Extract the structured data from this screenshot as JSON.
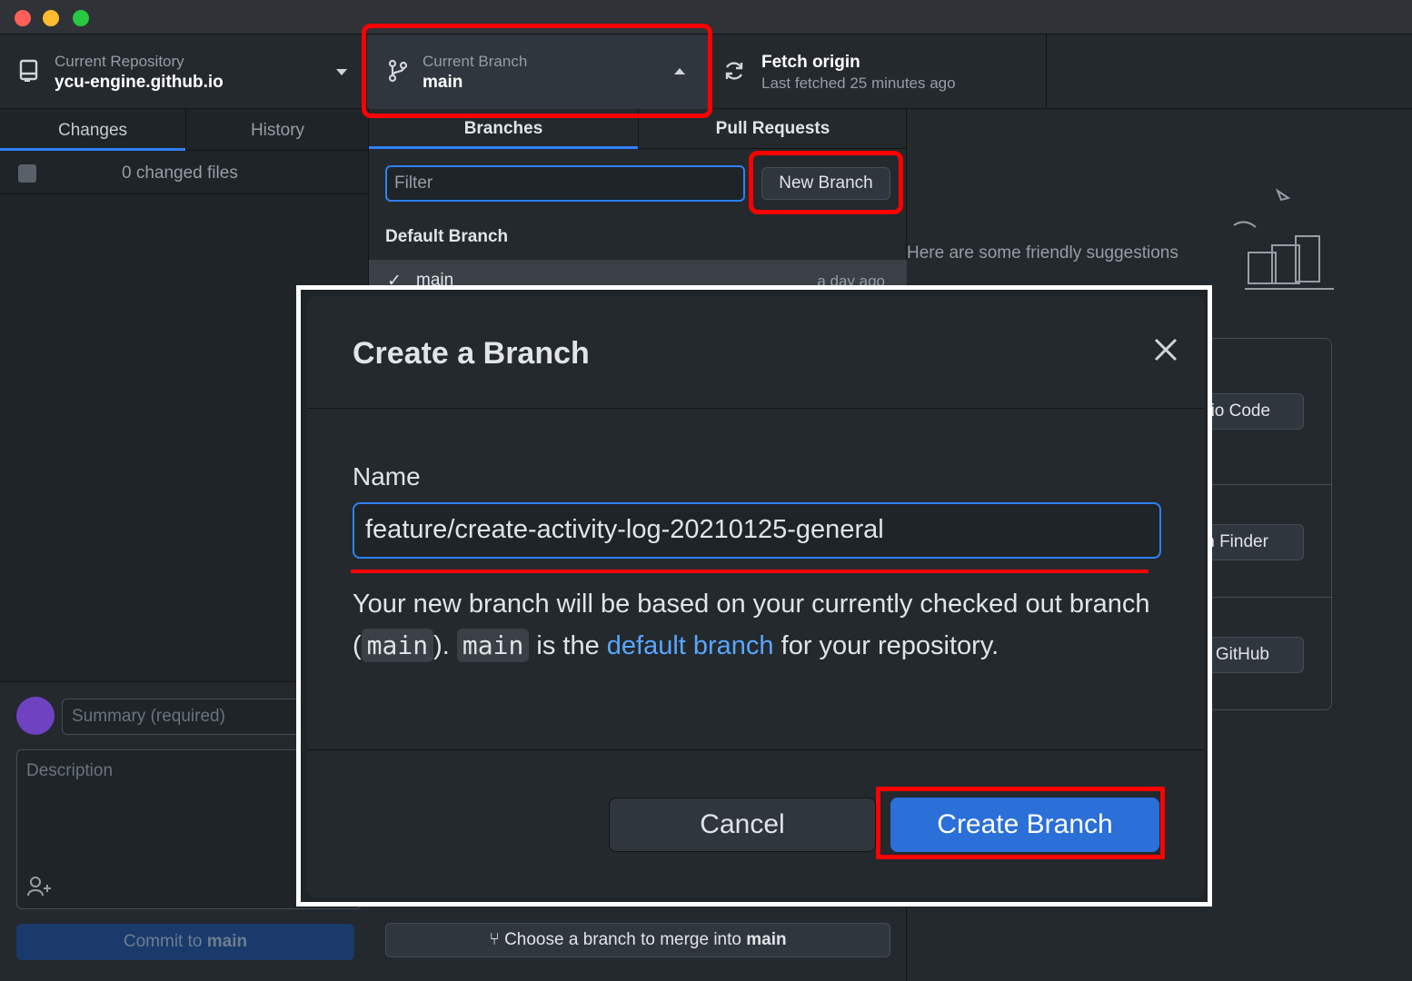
{
  "window": {
    "traffic_lights": [
      "close",
      "minimize",
      "zoom"
    ]
  },
  "toolbar": {
    "repo_label": "Current Repository",
    "repo_name": "ycu-engine.github.io",
    "branch_label": "Current Branch",
    "branch_name": "main",
    "fetch_title": "Fetch origin",
    "fetch_subtitle": "Last fetched 25 minutes ago"
  },
  "sidebar": {
    "tabs": [
      "Changes",
      "History"
    ],
    "changed_files": "0 changed files",
    "summary_placeholder": "Summary (required)",
    "description_placeholder": "Description",
    "commit_prefix": "Commit to ",
    "commit_branch": "main"
  },
  "branch_dropdown": {
    "tabs": [
      "Branches",
      "Pull Requests"
    ],
    "filter_placeholder": "Filter",
    "new_branch_label": "New Branch",
    "default_branch_heading": "Default Branch",
    "branches": [
      {
        "name": "main",
        "time": "a day ago",
        "checked": true
      }
    ],
    "merge_prefix": "Choose a branch to merge into ",
    "merge_branch": "main"
  },
  "background": {
    "suggestions_text": "Here are some friendly suggestions",
    "action_buttons": [
      "dio Code",
      "in Finder",
      "n GitHub"
    ]
  },
  "dialog": {
    "title": "Create a Branch",
    "name_label": "Name",
    "name_value": "feature/create-activity-log-20210125-general",
    "explain_1": "Your new branch will be based on your currently checked out branch (",
    "code_1": "main",
    "explain_2": "). ",
    "code_2": "main",
    "explain_3": " is the ",
    "link_text": "default branch",
    "explain_4": " for your repository.",
    "cancel_label": "Cancel",
    "create_label": "Create Branch"
  },
  "colors": {
    "accent": "#2f81f7",
    "primary_button": "#2b6fd9",
    "highlight": "#ff0000",
    "background": "#24292e"
  }
}
